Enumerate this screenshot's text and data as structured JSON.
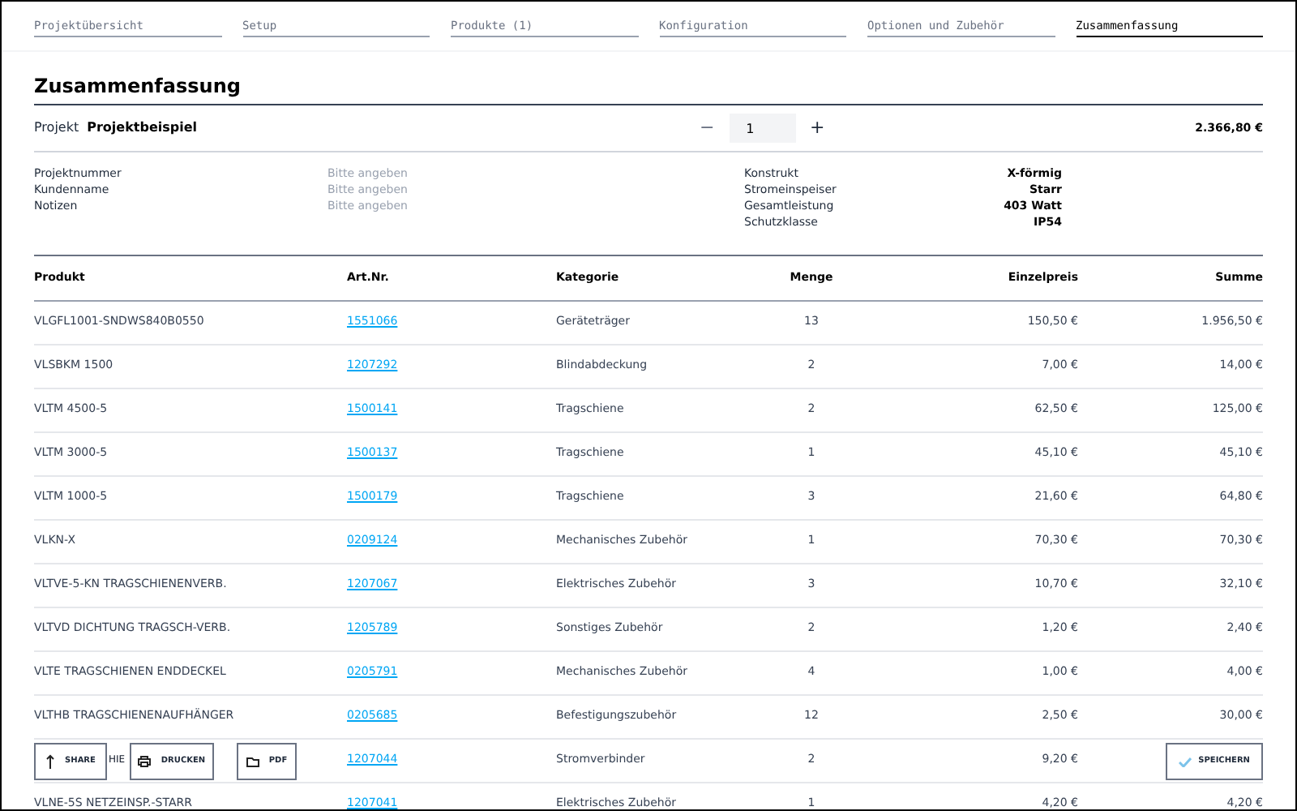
{
  "steps": [
    {
      "label": "Projektübersicht",
      "selected": false
    },
    {
      "label": "Setup",
      "selected": false
    },
    {
      "label": "Produkte (1)",
      "selected": false
    },
    {
      "label": "Konfiguration",
      "selected": false
    },
    {
      "label": "Optionen und Zubehör",
      "selected": false
    },
    {
      "label": "Zusammenfassung",
      "selected": true
    }
  ],
  "heading": "Zusammenfassung",
  "project": {
    "label": "Projekt",
    "name": "Projektbeispiel",
    "quantity": "1",
    "minus": "−",
    "plus": "+",
    "total": "2.366,80 €"
  },
  "details_left": [
    {
      "label": "Projektnummer",
      "placeholder": "Bitte angeben"
    },
    {
      "label": "Kundenname",
      "placeholder": "Bitte angeben"
    },
    {
      "label": "Notizen",
      "placeholder": "Bitte angeben"
    }
  ],
  "details_right": [
    {
      "label": "Konstrukt",
      "value": "X-förmig"
    },
    {
      "label": "Stromeinspeiser",
      "value": "Starr"
    },
    {
      "label": "Gesamtleistung",
      "value": "403 Watt"
    },
    {
      "label": "Schutzklasse",
      "value": "IP54"
    }
  ],
  "table": {
    "columns": [
      "Produkt",
      "Art.Nr.",
      "Kategorie",
      "Menge",
      "Einzelpreis",
      "Summe"
    ],
    "rows": [
      {
        "product": "VLGFL1001-SNDWS840B0550",
        "art": "1551066",
        "category": "Geräteträger",
        "qty": "13",
        "price": "150,50 €",
        "sum": "1.956,50 €"
      },
      {
        "product": "VLSBKM 1500",
        "art": "1207292",
        "category": "Blindabdeckung",
        "qty": "2",
        "price": "7,00 €",
        "sum": "14,00 €"
      },
      {
        "product": "VLTM 4500-5",
        "art": "1500141",
        "category": "Tragschiene",
        "qty": "2",
        "price": "62,50 €",
        "sum": "125,00 €"
      },
      {
        "product": "VLTM 3000-5",
        "art": "1500137",
        "category": "Tragschiene",
        "qty": "1",
        "price": "45,10 €",
        "sum": "45,10 €"
      },
      {
        "product": "VLTM 1000-5",
        "art": "1500179",
        "category": "Tragschiene",
        "qty": "3",
        "price": "21,60 €",
        "sum": "64,80 €"
      },
      {
        "product": "VLKN-X",
        "art": "0209124",
        "category": "Mechanisches Zubehör",
        "qty": "1",
        "price": "70,30 €",
        "sum": "70,30 €"
      },
      {
        "product": "VLTVE-5-KN TRAGSCHIENENVERB.",
        "art": "1207067",
        "category": "Elektrisches Zubehör",
        "qty": "3",
        "price": "10,70 €",
        "sum": "32,10 €"
      },
      {
        "product": "VLTVD DICHTUNG TRAGSCH-VERB.",
        "art": "1205789",
        "category": "Sonstiges Zubehör",
        "qty": "2",
        "price": "1,20 €",
        "sum": "2,40 €"
      },
      {
        "product": "VLTE TRAGSCHIENEN ENDDECKEL",
        "art": "0205791",
        "category": "Mechanisches Zubehör",
        "qty": "4",
        "price": "1,00 €",
        "sum": "4,00 €"
      },
      {
        "product": "VLTHB TRAGSCHIENENAUFHÄNGER",
        "art": "0205685",
        "category": "Befestigungszubehör",
        "qty": "12",
        "price": "2,50 €",
        "sum": "30,00 €"
      },
      {
        "product": "HIE",
        "covered": true,
        "art": "1207044",
        "category": "Stromverbinder",
        "qty": "2",
        "price": "9,20 €"
      },
      {
        "product": "VLNE-5S NETZEINSP.-STARR",
        "art": "1207041",
        "category": "Elektrisches Zubehör",
        "qty": "1",
        "price": "4,20 €",
        "sum": "4,20 €"
      }
    ]
  },
  "actions": [
    {
      "kind": "share",
      "label": "SHARE"
    },
    {
      "kind": "print",
      "label": "DRUCKEN"
    },
    {
      "kind": "pdf",
      "label": "PDF"
    }
  ],
  "save_button": {
    "label": "SPEICHERN"
  }
}
